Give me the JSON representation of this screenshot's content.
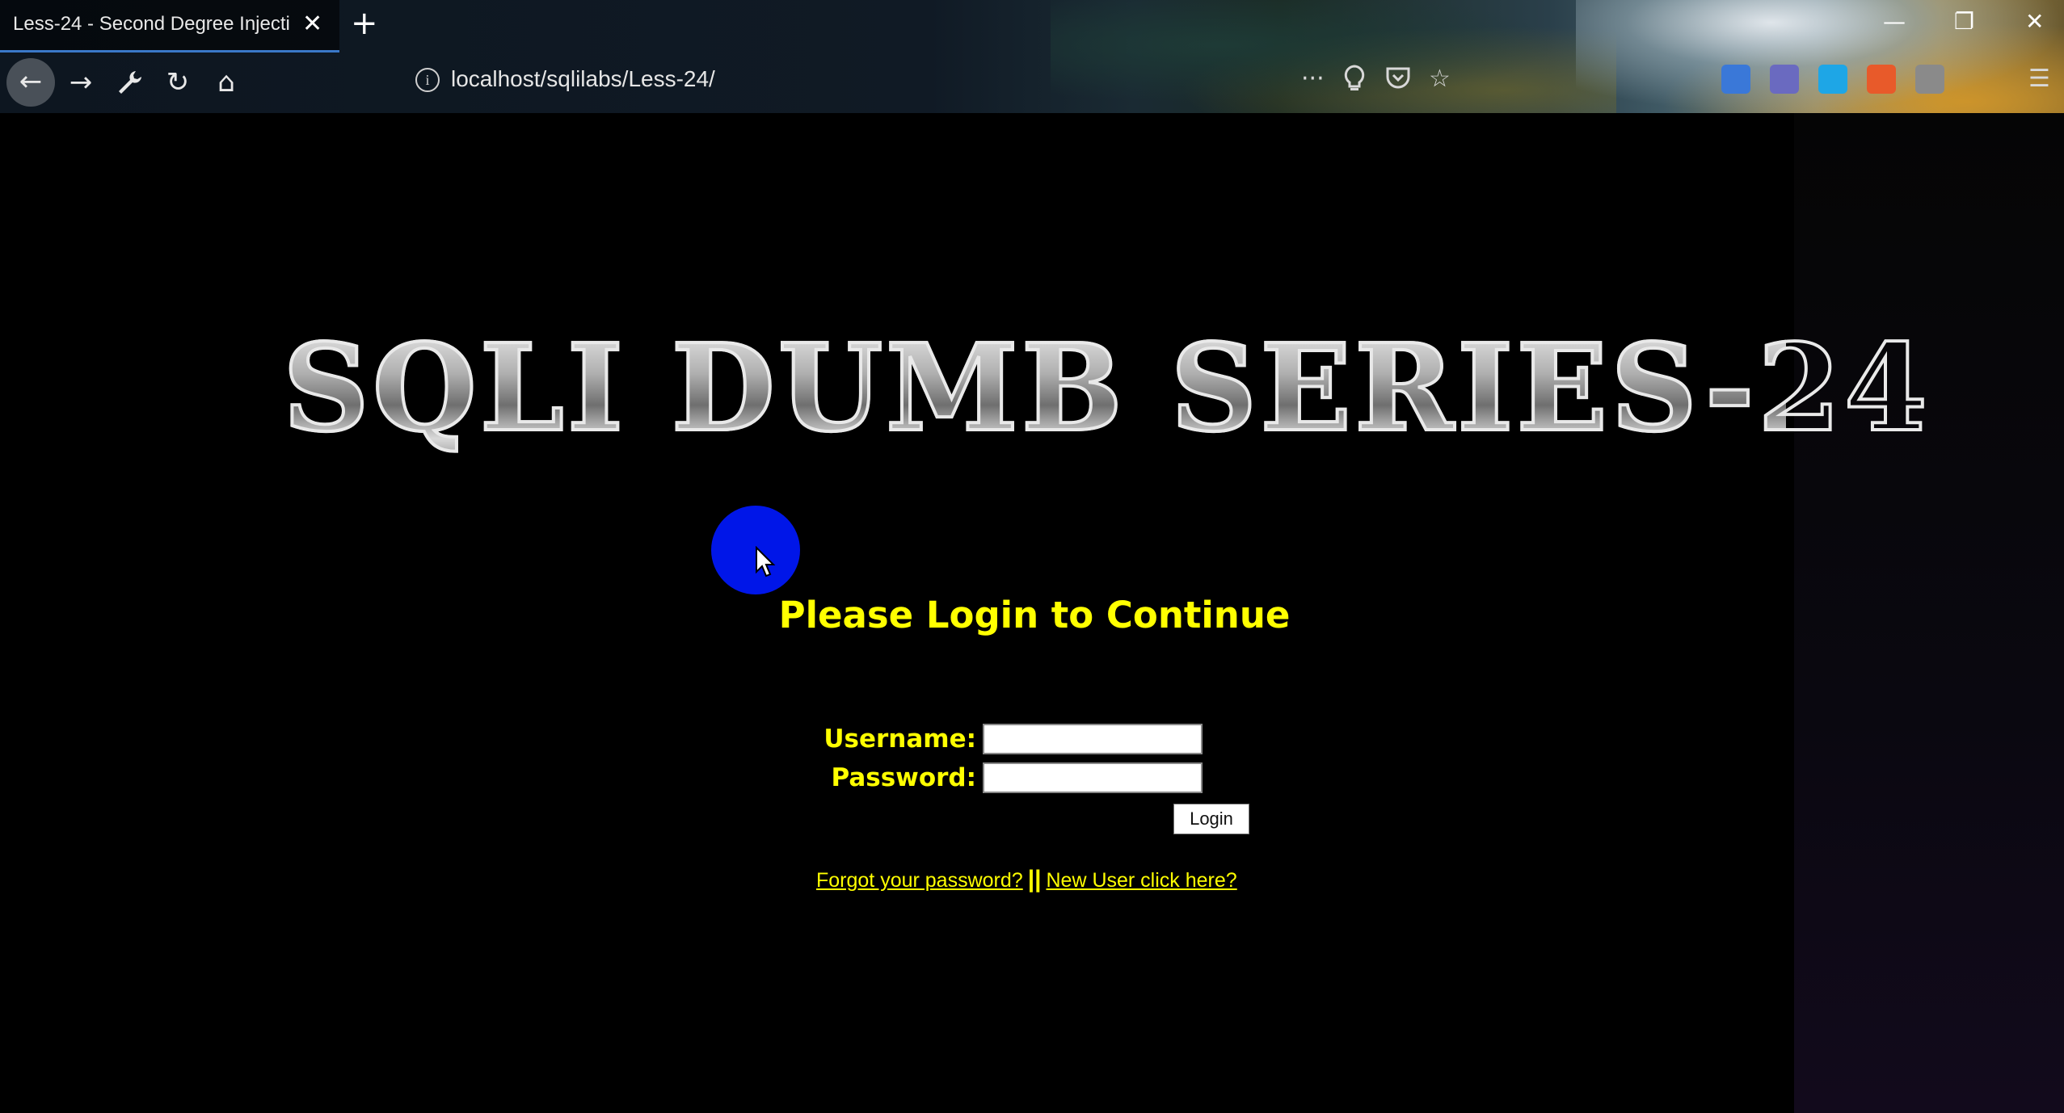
{
  "browser": {
    "tab_title": "Less-24 - Second Degree Injecti",
    "tab_close": "✕",
    "new_tab": "+",
    "url": "localhost/sqlilabs/Less-24/",
    "info_glyph": "i",
    "nav": {
      "back": "←",
      "forward": "→",
      "tools": "🔧",
      "reload": "↻",
      "home": "⌂"
    },
    "toolbar": {
      "more": "···",
      "lightbulb": "💡",
      "pocket": "⛉",
      "bookmark": "☆",
      "menu": "☰"
    },
    "window": {
      "minimize": "—",
      "restore": "❐",
      "close": "✕"
    },
    "extensions": [
      {
        "name": "ext-icon-1",
        "color": "#3a78d8"
      },
      {
        "name": "ext-icon-2",
        "color": "#6a6ac0"
      },
      {
        "name": "ext-icon-3",
        "color": "#1ea6e6"
      },
      {
        "name": "ext-icon-4",
        "color": "#e85a2a"
      },
      {
        "name": "ext-icon-5",
        "color": "#8a8a8a"
      }
    ]
  },
  "page": {
    "logo": "SQLI DUMB SERIES-24",
    "heading": "Please Login to Continue",
    "form": {
      "username_label": "Username:",
      "password_label": "Password:",
      "username_value": "",
      "password_value": "",
      "login_button": "Login"
    },
    "links": {
      "forgot": "Forgot your password?",
      "separator": "||",
      "new_user": "New User click here?"
    }
  },
  "colors": {
    "accent_text": "#ffff00",
    "cursor_halo": "#0016e8",
    "background": "#000000"
  }
}
